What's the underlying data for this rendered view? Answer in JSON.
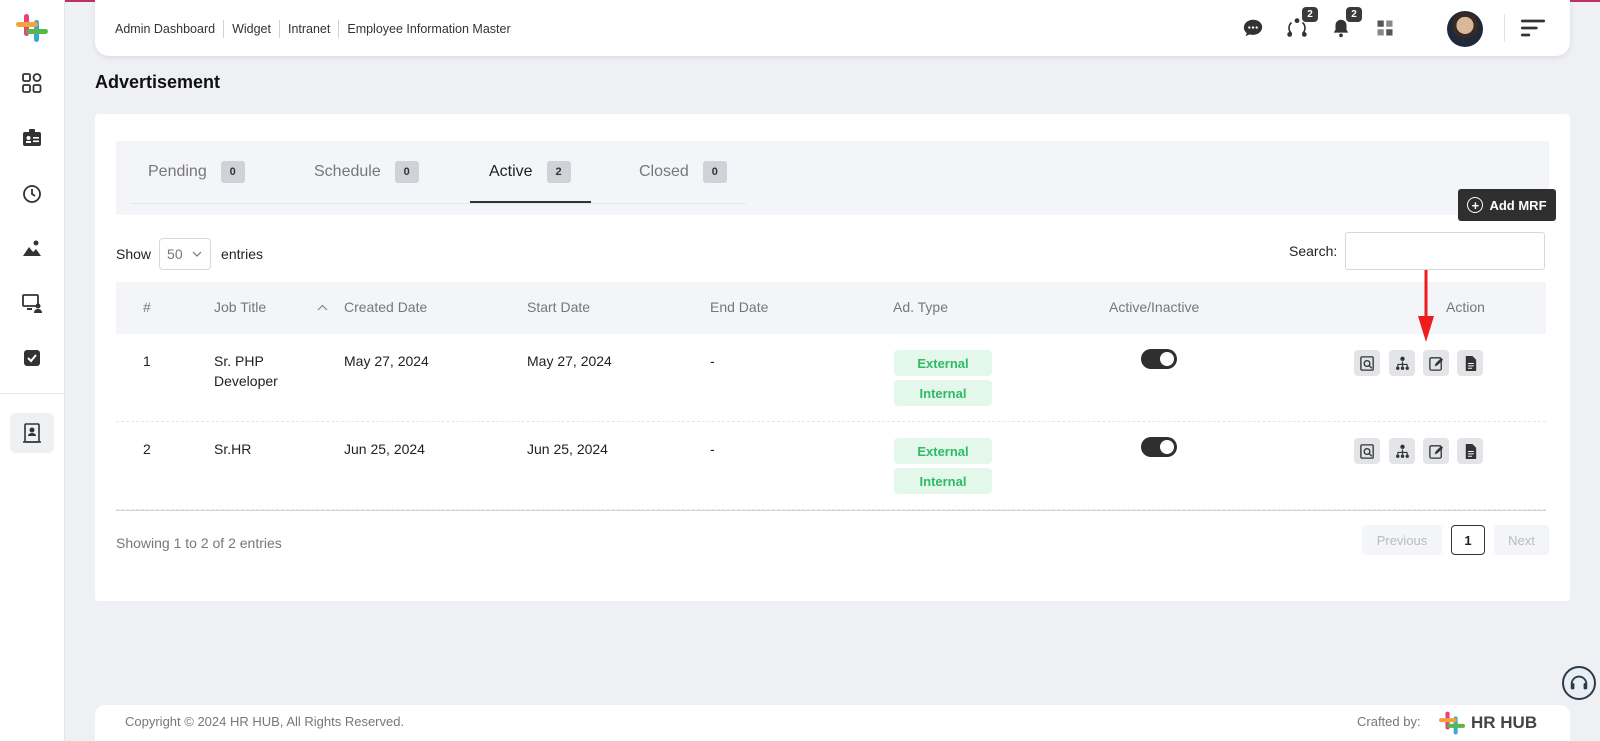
{
  "colors": {
    "accent_bar": "#c0325e",
    "dark_button": "#2f2f2f",
    "badge_green": "#2ebb63",
    "badge_bg": "#e3f7ea"
  },
  "breadcrumbs": [
    "Admin Dashboard",
    "Widget",
    "Intranet",
    "Employee Information Master"
  ],
  "header": {
    "network_badge": "2",
    "bell_badge": "2"
  },
  "sidebar": {
    "icons": [
      "dashboard-icon",
      "id-card-icon",
      "clock-icon",
      "image-icon",
      "monitor-user-icon",
      "checkbox-icon",
      "recruitment-icon"
    ]
  },
  "page": {
    "title": "Advertisement"
  },
  "tabs": [
    {
      "label": "Pending",
      "count": "0"
    },
    {
      "label": "Schedule",
      "count": "0"
    },
    {
      "label": "Active",
      "count": "2"
    },
    {
      "label": "Closed",
      "count": "0"
    }
  ],
  "add_button": {
    "label": "Add MRF"
  },
  "length": {
    "show": "Show",
    "value": "50",
    "entries": "entries"
  },
  "search": {
    "label": "Search:",
    "value": ""
  },
  "table": {
    "headers": [
      "#",
      "Job Title",
      "Created Date",
      "Start Date",
      "End Date",
      "Ad. Type",
      "Active/Inactive",
      "Action"
    ],
    "rows": [
      {
        "num": "1",
        "title_line1": "Sr. PHP",
        "title_line2": "Developer",
        "created": "May 27, 2024",
        "start": "May 27, 2024",
        "end": "-",
        "types": [
          "External",
          "Internal"
        ],
        "active": true
      },
      {
        "num": "2",
        "title_line1": "Sr.HR",
        "title_line2": "",
        "created": "Jun 25, 2024",
        "start": "Jun 25, 2024",
        "end": "-",
        "types": [
          "External",
          "Internal"
        ],
        "active": true
      }
    ]
  },
  "pagination": {
    "info": "Showing 1 to 2 of 2 entries",
    "previous": "Previous",
    "current": "1",
    "next": "Next"
  },
  "footer": {
    "copyright": "Copyright © 2024 HR HUB, All Rights Reserved.",
    "crafted_by": "Crafted by:",
    "brand": "HR HUB"
  }
}
